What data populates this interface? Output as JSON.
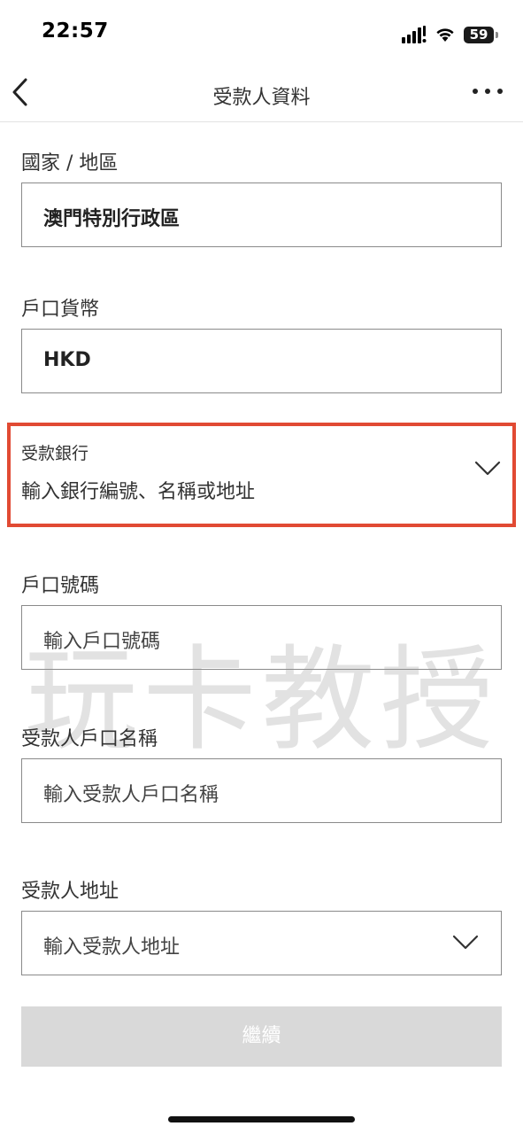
{
  "status_bar": {
    "time": "22:57",
    "battery": "59"
  },
  "nav": {
    "title": "受款人資料",
    "back_icon": "chevron-left-icon",
    "more_icon": "ellipsis-icon"
  },
  "fields": {
    "country": {
      "label": "國家 / 地區",
      "value": "澳門特別行政區"
    },
    "currency": {
      "label": "戶口貨幣",
      "value": "HKD"
    },
    "bank": {
      "label": "受款銀行",
      "placeholder": "輸入銀行編號、名稱或地址",
      "icon": "chevron-down-icon"
    },
    "account_number": {
      "label": "戶口號碼",
      "placeholder": "輸入戶口號碼"
    },
    "account_name": {
      "label": "受款人戶口名稱",
      "placeholder": "輸入受款人戶口名稱"
    },
    "address": {
      "label": "受款人地址",
      "placeholder": "輸入受款人地址",
      "icon": "chevron-down-icon"
    }
  },
  "watermark": "玩卡教授",
  "continue_label": "繼續",
  "colors": {
    "highlight": "#e14a33",
    "disabled_button": "#d9d9d9",
    "border": "#8a8a8a"
  }
}
